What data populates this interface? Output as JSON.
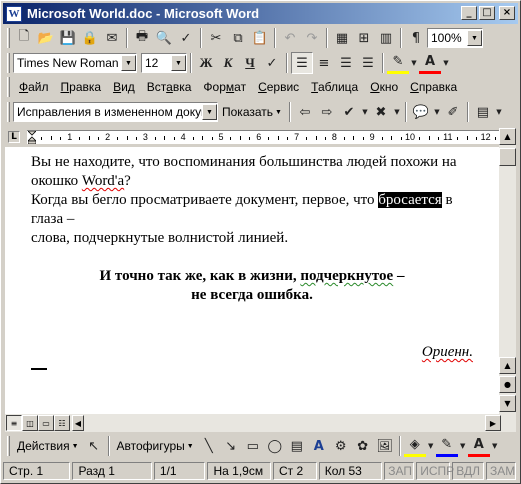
{
  "window": {
    "title": "Microsoft World.doc - Microsoft Word",
    "buttons": [
      "_",
      "□",
      "×"
    ]
  },
  "standard_toolbar": {
    "zoom": "100%"
  },
  "formatting_toolbar": {
    "font": "Times New Roman",
    "size": "12",
    "bold": "Ж",
    "italic": "К",
    "underline": "Ч"
  },
  "menu": {
    "items": [
      {
        "ul": "Ф",
        "rest": "айл"
      },
      {
        "ul": "П",
        "rest": "равка"
      },
      {
        "ul": "В",
        "rest": "ид"
      },
      {
        "ul": "",
        "mid_pre": "Вст",
        "mid_ul": "а",
        "rest": "вка"
      },
      {
        "ul": "",
        "mid_pre": "Фор",
        "mid_ul": "м",
        "rest": "ат"
      },
      {
        "ul": "С",
        "rest": "ервис"
      },
      {
        "ul": "Т",
        "rest": "аблица"
      },
      {
        "ul": "О",
        "rest": "кно"
      },
      {
        "ul": "С",
        "rest": "правка"
      }
    ]
  },
  "review_toolbar": {
    "display_mode": "Исправления в измененном докуме",
    "show_label": "Показать"
  },
  "ruler": {
    "corner": "L",
    "numbers": [
      "1",
      "2",
      "3",
      "4",
      "5",
      "6",
      "7",
      "8",
      "9",
      "10",
      "11",
      "12"
    ]
  },
  "document": {
    "line1_pre": "Вы не находите, что воспоминания большинства людей похожи на окошко ",
    "line1_word": "Word'a",
    "line1_post": "?",
    "line2_pre": "Когда вы бегло просматриваете документ, первое, что ",
    "line2_selected": "бросается",
    "line2_post": " в глаза –",
    "line3": "слова, подчеркнутые волнистой линией.",
    "quote_pre": "И точно так же, как в жизни, ",
    "quote_word": "подчеркнутое",
    "quote_post": " –",
    "quote_line2": "не всегда ошибка.",
    "signature": "Ориенн."
  },
  "drawing_toolbar": {
    "actions_label": "Действия",
    "autoshapes_label": "Автофигуры"
  },
  "status_bar": {
    "page": "Стр. 1",
    "section": "Разд 1",
    "pages": "1/1",
    "at": "На 1,9см",
    "line": "Ст 2",
    "col": "Кол 53",
    "rec": "ЗАП",
    "trk": "ИСПР",
    "ext": "ВДЛ",
    "ovr": "ЗАМ"
  },
  "colors": {
    "title_start": "#0a246a",
    "title_end": "#a6caf0",
    "spell_error": "#e00000",
    "highlight": "#ffff00",
    "font_color": "#ff0000"
  }
}
